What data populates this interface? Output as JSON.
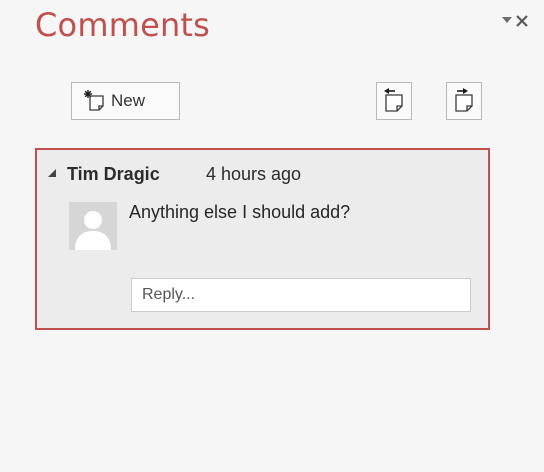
{
  "pane": {
    "title": "Comments",
    "options_icon": "chevron-down-icon",
    "close_icon": "close-icon"
  },
  "toolbar": {
    "new_label": "New",
    "new_icon": "new-comment-icon",
    "previous_icon": "previous-comment-icon",
    "next_icon": "next-comment-icon"
  },
  "comment": {
    "author": "Tim Dragic",
    "timestamp": "4 hours ago",
    "text": "Anything else I should add?",
    "avatar_icon": "person-icon",
    "reply_placeholder": "Reply..."
  },
  "colors": {
    "accent": "#c0504d",
    "card_background": "#ececec",
    "pane_background": "#f6f6f6"
  }
}
